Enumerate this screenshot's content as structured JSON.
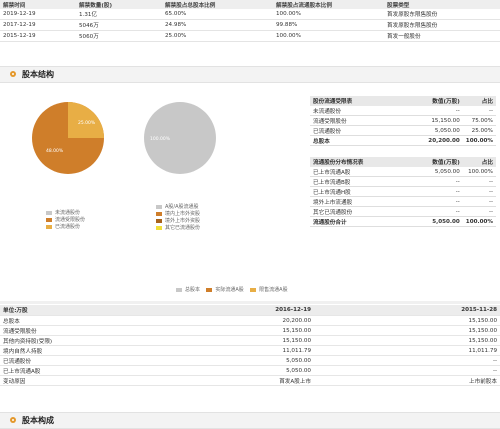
{
  "unlock_table": {
    "headers": [
      "解禁时间",
      "解禁数量(股)",
      "解禁股占总股本比例",
      "解禁股占流通股本比例",
      "股票类型"
    ],
    "rows": [
      [
        "2019-12-19",
        "1.31亿",
        "65.00%",
        "100.00%",
        "首发原股东限售股份"
      ],
      [
        "2017-12-19",
        "5046万",
        "24.98%",
        "99.88%",
        "首发原股东限售股份"
      ],
      [
        "2015-12-19",
        "5060万",
        "25.00%",
        "100.00%",
        "首发一般股份"
      ]
    ]
  },
  "section1": {
    "title": "股本结构"
  },
  "pie1": {
    "labels": [
      "48.00%",
      "25.00%"
    ],
    "legend": [
      "未流通股份",
      "流通受限股份",
      "已流通股份"
    ]
  },
  "pie2": {
    "labels": [
      "100.00%"
    ],
    "legend": [
      "A股/A股流通股",
      "境内上市外资股",
      "境外上市外资股",
      "其它已流通股份"
    ]
  },
  "share_structure": {
    "headers": [
      "股份流通受限表",
      "数值(万股)",
      "占比"
    ],
    "rows": [
      [
        "未流通股份",
        "--",
        "--"
      ],
      [
        "流通受限股份",
        "15,150.00",
        "75.00%"
      ],
      [
        "已流通股份",
        "5,050.00",
        "25.00%"
      ]
    ],
    "total": [
      "总股本",
      "20,200.00",
      "100.00%"
    ]
  },
  "distribution": {
    "headers": [
      "流通股份分布情况表",
      "数值(万股)",
      "占比"
    ],
    "rows": [
      [
        "已上市流通A股",
        "5,050.00",
        "100.00%"
      ],
      [
        "已上市流通B股",
        "--",
        "--"
      ],
      [
        "已上市流通H股",
        "--",
        "--"
      ],
      [
        "境外上市流通股",
        "--",
        "--"
      ],
      [
        "其它已流通股份",
        "--",
        "--"
      ]
    ],
    "total": [
      "流通股份合计",
      "5,050.00",
      "100.00%"
    ]
  },
  "bar_legend": [
    "总股本",
    "实际流通A股",
    "限售流通A股"
  ],
  "bottom_table": {
    "rows": [
      [
        "单位:万股",
        "2016-12-19",
        "2015-11-28"
      ],
      [
        "总股本",
        "20,200.00",
        "15,150.00"
      ],
      [
        "流通受限股份",
        "15,150.00",
        "15,150.00"
      ],
      [
        "其他内资持股(受限)",
        "15,150.00",
        "15,150.00"
      ],
      [
        "境内自然人持股",
        "11,011.79",
        "11,011.79"
      ],
      [
        "已流通股份",
        "5,050.00",
        "--"
      ],
      [
        "已上市流通A股",
        "5,050.00",
        "--"
      ],
      [
        "变动原因",
        "首发A股上市",
        "上市前股本"
      ]
    ]
  },
  "section2": {
    "title": "股本构成"
  },
  "colors": {
    "orange": "#cf7e2a",
    "light_orange": "#e8ae45",
    "gray": "#c8c8c8",
    "yellow": "#f1df3a",
    "brown": "#a8631c"
  }
}
